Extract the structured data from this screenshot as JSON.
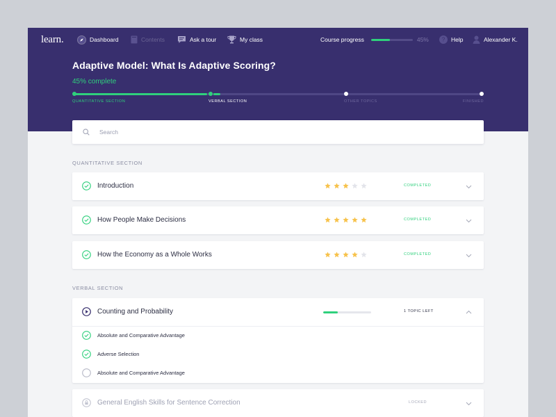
{
  "nav": {
    "logo": "learn.",
    "items": [
      {
        "label": "Dashboard",
        "icon": "compass-icon"
      },
      {
        "label": "Contents",
        "icon": "book-icon"
      },
      {
        "label": "Ask a tour",
        "icon": "chat-icon"
      },
      {
        "label": "My class",
        "icon": "trophy-icon"
      }
    ],
    "course_progress_label": "Course progress",
    "course_progress_value": 0.45,
    "course_progress_pct": "45%",
    "help_label": "Help",
    "help_icon": "question-icon",
    "user_name": "Alexander K.",
    "user_icon": "user-icon"
  },
  "course": {
    "title": "Adaptive Model: What Is Adaptive Scoring?",
    "complete_text": "45% complete",
    "stages": [
      "Quantitative section",
      "Verbal section",
      "Other topics",
      "Finished"
    ]
  },
  "search": {
    "placeholder": "Search",
    "value": ""
  },
  "sections": [
    {
      "title": "Quantitative section",
      "items": [
        {
          "title": "Introduction",
          "rating": 3,
          "status": "Completed"
        },
        {
          "title": "How People Make Decisions",
          "rating": 5,
          "status": "Completed"
        },
        {
          "title": "How the Economy as a Whole Works",
          "rating": 4,
          "status": "Completed"
        }
      ]
    },
    {
      "title": "Verbal section",
      "active": {
        "title": "Counting and Probability",
        "progress": 0.3,
        "status": "1 topic left",
        "subtopics": [
          {
            "label": "Absolute and Comparative Advantage",
            "done": true
          },
          {
            "label": "Adverse Selection",
            "done": true
          },
          {
            "label": "Absolute and Comparative Advantage",
            "done": false
          }
        ]
      },
      "locked": {
        "title": "General English Skills for Sentence Correction",
        "status": "Locked"
      }
    }
  ],
  "colors": {
    "header_bg": "#382f6e",
    "accent_green": "#2fd07c",
    "star_gold": "#f7c24b",
    "star_empty": "#e3e4ea",
    "page_bg": "#f3f4f6"
  }
}
